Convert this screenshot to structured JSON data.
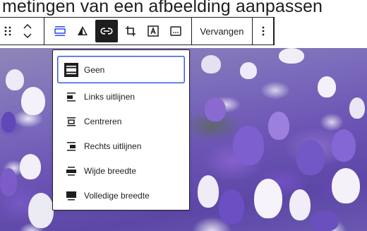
{
  "page": {
    "title": "metingen van een afbeelding aanpassen"
  },
  "toolbar": {
    "replace_label": "Vervangen"
  },
  "align_menu": {
    "items": [
      {
        "label": "Geen",
        "icon": "align-none-icon",
        "selected": true
      },
      {
        "label": "Links uitlijnen",
        "icon": "align-left-icon",
        "selected": false
      },
      {
        "label": "Centreren",
        "icon": "align-center-icon",
        "selected": false
      },
      {
        "label": "Rechts uitlijnen",
        "icon": "align-right-icon",
        "selected": false
      },
      {
        "label": "Wijde breedte",
        "icon": "align-wide-icon",
        "selected": false
      },
      {
        "label": "Volledige breedte",
        "icon": "align-full-icon",
        "selected": false
      }
    ]
  },
  "colors": {
    "accent": "#3858e9",
    "text": "#1e1e1e",
    "active_button_bg": "#1e1e1e"
  }
}
